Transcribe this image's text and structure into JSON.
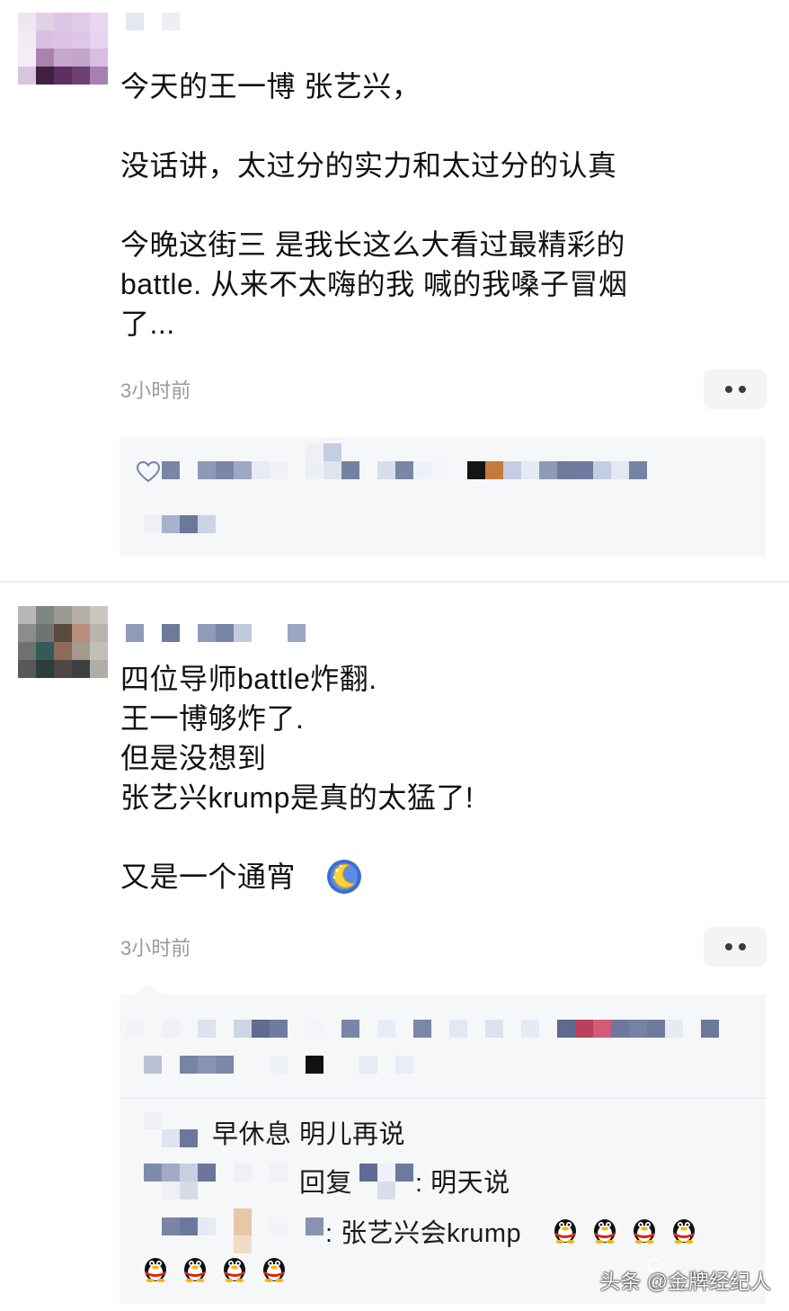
{
  "comments": [
    {
      "text": "今天的王一博 张艺兴，\n\n没话讲，太过分的实力和太过分的认真\n\n今晚这街三 是我长这么大看过最精彩的\nbattle. 从来不太嗨的我 喊的我嗓子冒烟\n了...",
      "time": "3小时前"
    },
    {
      "text": "四位导师battle炸翻.\n王一博够炸了.\n但是没想到\n张艺兴krump是真的太猛了!\n\n又是一个通宵",
      "time": "3小时前"
    }
  ],
  "replies": [
    {
      "text": "早休息 明儿再说"
    },
    {
      "prefix": "回复",
      "text": ": 明天说"
    },
    {
      "text": ": 张艺兴会krump"
    }
  ],
  "icons": {
    "like": "heart-outline-icon",
    "more": "more-dots-icon",
    "moon": "moon-emoji-icon",
    "penguin": "qq-penguin-emoji-icon",
    "watermark": "toutiao-icon"
  },
  "watermark": "头条 @金牌经纪人",
  "colors": {
    "text": "#111111",
    "time": "#9a9a9a",
    "reply_bg": "#f6f7f9",
    "divider": "#eceef1"
  }
}
